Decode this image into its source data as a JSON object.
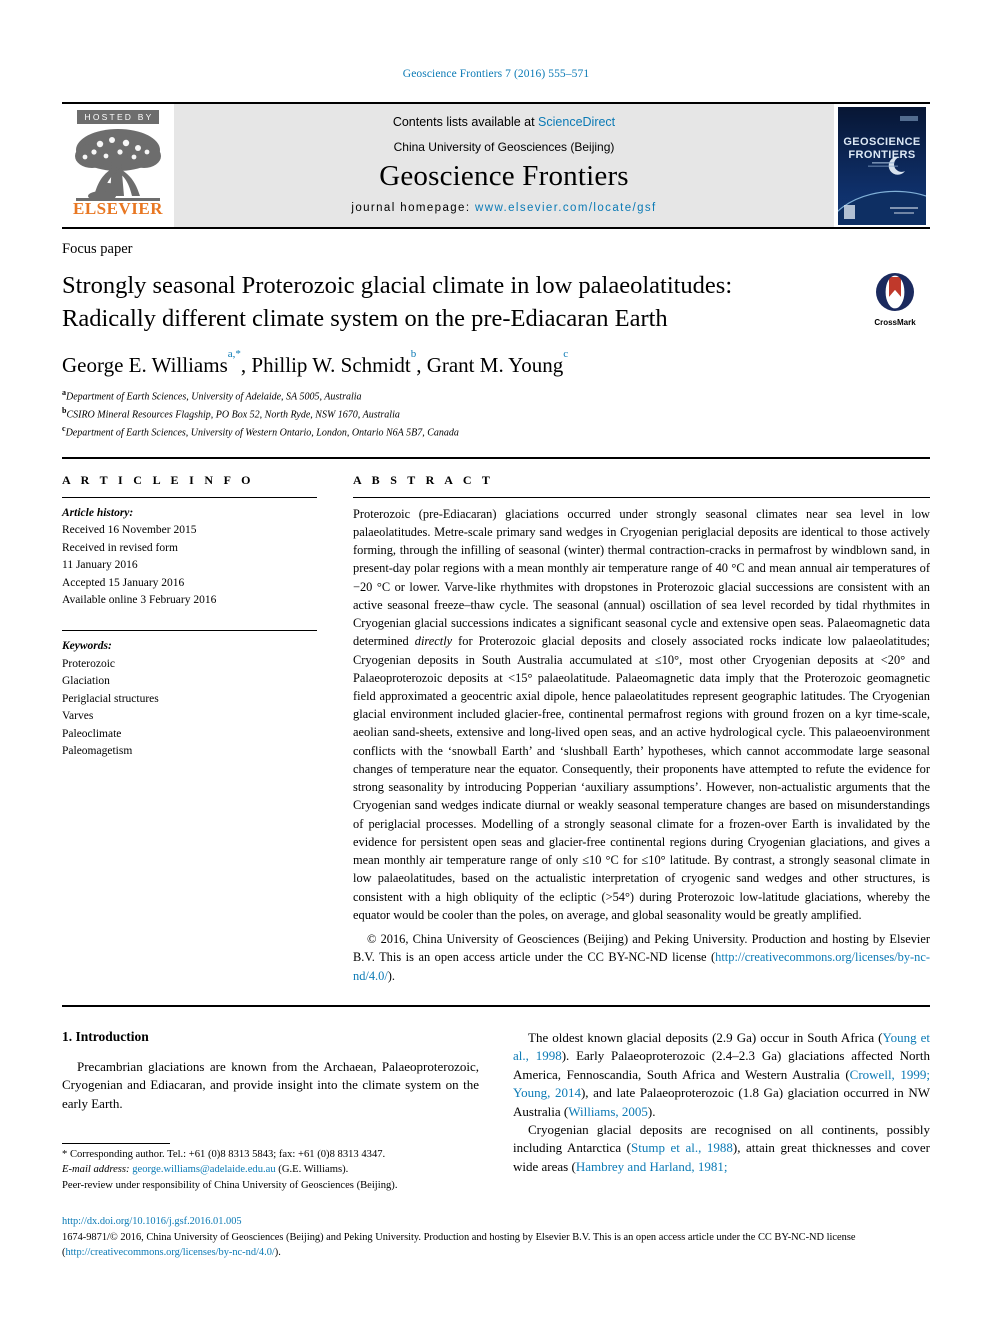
{
  "running_head": "Geoscience Frontiers 7 (2016) 555–571",
  "masthead": {
    "hosted_by": "HOSTED BY",
    "elsevier": "ELSEVIER",
    "contents_prefix": "Contents lists available at ",
    "sciencedirect": "ScienceDirect",
    "publisher": "China University of Geosciences (Beijing)",
    "journal_name": "Geoscience Frontiers",
    "homepage_prefix": "journal homepage: ",
    "homepage_url": "www.elsevier.com/locate/gsf",
    "cover_title_line1": "GEOSCIENCE",
    "cover_title_line2": "FRONTIERS"
  },
  "paper": {
    "type": "Focus paper",
    "title_line1": "Strongly seasonal Proterozoic glacial climate in low palaeolatitudes:",
    "title_line2": "Radically different climate system on the pre-Ediacaran Earth",
    "crossmark_label": "CrossMark",
    "authors": [
      {
        "name": "George E. Williams",
        "marks": "a,*"
      },
      {
        "name": "Phillip W. Schmidt",
        "marks": "b"
      },
      {
        "name": "Grant M. Young",
        "marks": "c"
      }
    ],
    "affiliations": [
      {
        "mark": "a",
        "text": "Department of Earth Sciences, University of Adelaide, SA 5005, Australia"
      },
      {
        "mark": "b",
        "text": "CSIRO Mineral Resources Flagship, PO Box 52, North Ryde, NSW 1670, Australia"
      },
      {
        "mark": "c",
        "text": "Department of Earth Sciences, University of Western Ontario, London, Ontario N6A 5B7, Canada"
      }
    ]
  },
  "article_info": {
    "heading": "A R T I C L E   I N F O",
    "history_label": "Article history:",
    "history": [
      "Received 16 November 2015",
      "Received in revised form",
      "11 January 2016",
      "Accepted 15 January 2016",
      "Available online 3 February 2016"
    ],
    "keywords_label": "Keywords:",
    "keywords": [
      "Proterozoic",
      "Glaciation",
      "Periglacial structures",
      "Varves",
      "Paleoclimate",
      "Paleomagetism"
    ]
  },
  "abstract": {
    "heading": "A B S T R A C T",
    "text_part1": "Proterozoic (pre-Ediacaran) glaciations occurred under strongly seasonal climates near sea level in low palaeolatitudes. Metre-scale primary sand wedges in Cryogenian periglacial deposits are identical to those actively forming, through the infilling of seasonal (winter) thermal contraction-cracks in permafrost by windblown sand, in present-day polar regions with a mean monthly air temperature range of 40 °C and mean annual air temperatures of −20 °C or lower. Varve-like rhythmites with dropstones in Proterozoic glacial successions are consistent with an active seasonal freeze–thaw cycle. The seasonal (annual) oscillation of sea level recorded by tidal rhythmites in Cryogenian glacial successions indicates a significant seasonal cycle and extensive open seas. Palaeomagnetic data determined ",
    "italic1": "directly",
    "text_part2": " for Proterozoic glacial deposits and closely associated rocks indicate low palaeolatitudes; Cryogenian deposits in South Australia accumulated at ≤10°, most other Cryogenian deposits at <20° and Palaeoproterozoic deposits at <15° palaeolatitude. Palaeomagnetic data imply that the Proterozoic geomagnetic field approximated a geocentric axial dipole, hence palaeolatitudes represent geographic latitudes. The Cryogenian glacial environment included glacier-free, continental permafrost regions with ground frozen on a kyr time-scale, aeolian sand-sheets, extensive and long-lived open seas, and an active hydrological cycle. This palaeoenvironment conflicts with the ‘snowball Earth’ and ‘slushball Earth’ hypotheses, which cannot accommodate large seasonal changes of temperature near the equator. Consequently, their proponents have attempted to refute the evidence for strong seasonality by introducing Popperian ‘auxiliary assumptions’. However, non-actualistic arguments that the Cryogenian sand wedges indicate diurnal or weakly seasonal temperature changes are based on misunderstandings of periglacial processes. Modelling of a strongly seasonal climate for a frozen-over Earth is invalidated by the evidence for persistent open seas and glacier-free continental regions during Cryogenian glaciations, and gives a mean monthly air temperature range of only ≤10 °C for ≤10° latitude. By contrast, a strongly seasonal climate in low palaeolatitudes, based on the actualistic interpretation of cryogenic sand wedges and other structures, is consistent with a high obliquity of the ecliptic (>54°) during Proterozoic low-latitude glaciations, whereby the equator would be cooler than the poles, on average, and global seasonality would be greatly amplified.",
    "copyright_text": "© 2016, China University of Geosciences (Beijing) and Peking University. Production and hosting by Elsevier B.V. This is an open access article under the CC BY-NC-ND license (",
    "copyright_link": "http://creativecommons.org/licenses/by-nc-nd/4.0/",
    "copyright_tail": ")."
  },
  "body": {
    "section_number_title": "1. Introduction",
    "left_paragraph": "Precambrian glaciations are known from the Archaean, Palaeoproterozoic, Cryogenian and Ediacaran, and provide insight into the climate system on the early Earth.",
    "right_paragraph_1_a": "The oldest known glacial deposits (2.9 Ga) occur in South Africa (",
    "right_ref_1": "Young et al., 1998",
    "right_paragraph_1_b": "). Early Palaeoproterozoic (2.4–2.3 Ga) glaciations affected North America, Fennoscandia, South Africa and Western Australia (",
    "right_ref_2": "Crowell, 1999; Young, 2014",
    "right_paragraph_1_c": "), and late Palaeoproterozoic (1.8 Ga) glaciation occurred in NW Australia (",
    "right_ref_3": "Williams, 2005",
    "right_paragraph_1_d": ").",
    "right_paragraph_2_a": "Cryogenian glacial deposits are recognised on all continents, possibly including Antarctica (",
    "right_ref_4": "Stump et al., 1988",
    "right_paragraph_2_b": "), attain great thicknesses and cover wide areas (",
    "right_ref_5": "Hambrey and Harland, 1981;"
  },
  "footnotes": {
    "corresponding": "* Corresponding author. Tel.: +61 (0)8 8313 5843; fax: +61 (0)8 8313 4347.",
    "email_label": "E-mail address:",
    "email": "george.williams@adelaide.edu.au",
    "email_suffix": " (G.E. Williams).",
    "peer_review": "Peer-review under responsibility of China University of Geosciences (Beijing)."
  },
  "footer": {
    "doi": "http://dx.doi.org/10.1016/j.gsf.2016.01.005",
    "issn_line": "1674-9871/© 2016, China University of Geosciences (Beijing) and Peking University. Production and hosting by Elsevier B.V. This is an open access article under the CC BY-NC-ND license (",
    "license_link": "http://creativecommons.org/licenses/by-nc-nd/4.0/",
    "license_tail": ")."
  },
  "colors": {
    "link": "#0b7ab5",
    "elsevier_orange": "#e87722",
    "masthead_grey": "#e6e6e6"
  }
}
